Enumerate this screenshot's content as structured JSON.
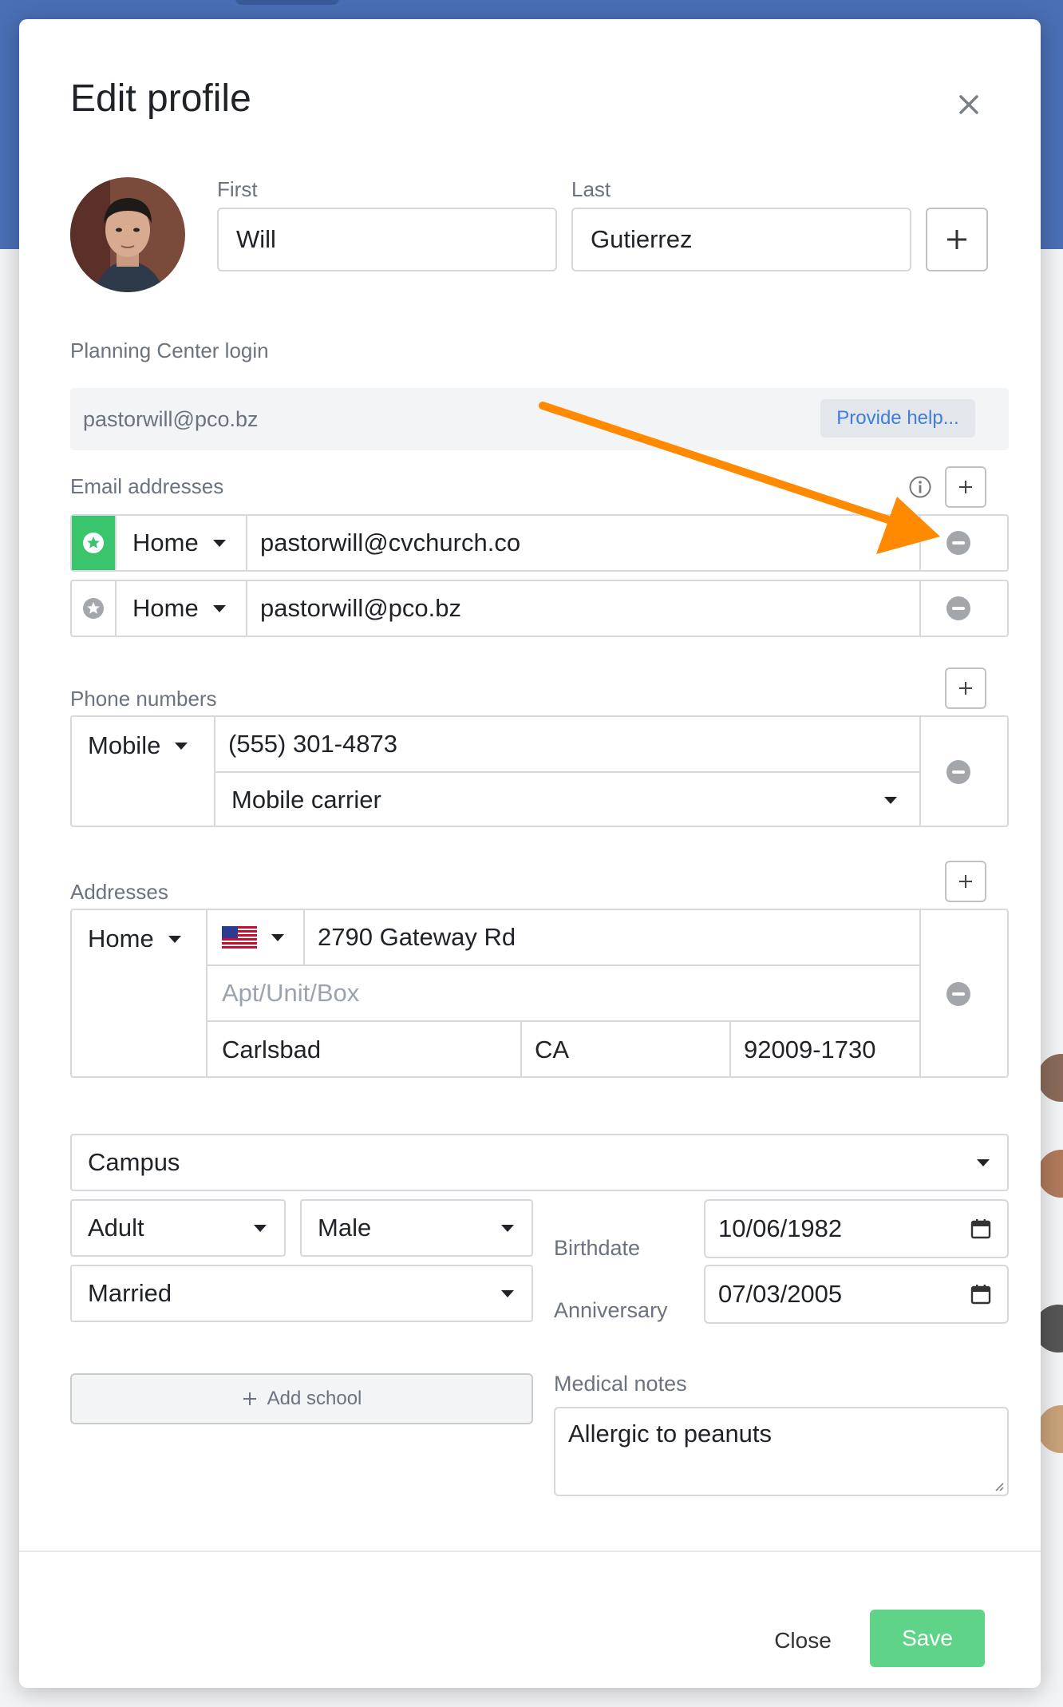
{
  "modal": {
    "title": "Edit profile"
  },
  "name": {
    "first_label": "First",
    "first_value": "Will",
    "last_label": "Last",
    "last_value": "Gutierrez"
  },
  "login": {
    "label": "Planning Center login",
    "value": "pastorwill@pco.bz",
    "help_label": "Provide help..."
  },
  "emails": {
    "label": "Email addresses",
    "items": [
      {
        "type": "Home",
        "value": "pastorwill@cvchurch.co",
        "primary": true
      },
      {
        "type": "Home",
        "value": "pastorwill@pco.bz",
        "primary": false
      }
    ]
  },
  "phones": {
    "label": "Phone numbers",
    "items": [
      {
        "type": "Mobile",
        "number": "(555) 301-4873",
        "carrier": "Mobile carrier"
      }
    ]
  },
  "addresses": {
    "label": "Addresses",
    "items": [
      {
        "type": "Home",
        "street": "2790 Gateway Rd",
        "apt_placeholder": "Apt/Unit/Box",
        "city": "Carlsbad",
        "state": "CA",
        "zip": "92009-1730"
      }
    ]
  },
  "details": {
    "campus": "Campus",
    "membership": "Adult",
    "gender": "Male",
    "marital": "Married",
    "birthdate_label": "Birthdate",
    "birthdate": "10/06/1982",
    "anniversary_label": "Anniversary",
    "anniversary": "07/03/2005"
  },
  "school": {
    "add_label": "Add school"
  },
  "medical": {
    "label": "Medical notes",
    "value": "Allergic to peanuts"
  },
  "footer": {
    "close_label": "Close",
    "save_label": "Save"
  },
  "colors": {
    "primary_green": "#5fd488",
    "link_blue": "#3f7dd8",
    "annotation_orange": "#ff8a00",
    "header_blue": "#4a6fb5"
  },
  "icons": [
    "close-icon",
    "plus-icon",
    "info-icon",
    "star-icon",
    "minus-circle-icon",
    "us-flag-icon",
    "calendar-icon",
    "chevron-down-icon"
  ]
}
